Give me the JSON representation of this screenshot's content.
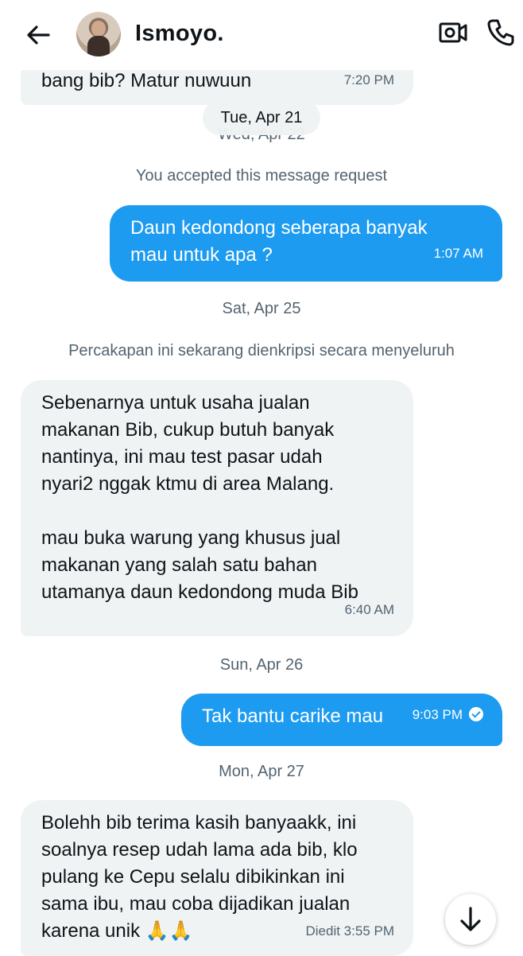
{
  "header": {
    "contact_name": "Ismoyo.",
    "back_icon": "arrow-left-icon",
    "video_icon": "video-call-icon",
    "call_icon": "phone-icon"
  },
  "messages": [
    {
      "text": "bang bib? Matur nuwuun",
      "time": "7:20 PM"
    },
    {
      "text": "Daun kedondong seberapa banyak\nmau untuk apa ?",
      "time": "1:07 AM"
    },
    {
      "text": "Sebenarnya untuk usaha jualan\nmakanan Bib,  cukup butuh banyak\nnantinya, ini mau test pasar udah\nnyari2 nggak ktmu di area Malang.\n\nmau buka warung yang khusus jual\nmakanan yang salah satu bahan\nutamanya daun kedondong muda Bib",
      "time": "6:40 AM"
    },
    {
      "text": "Tak bantu carike mau",
      "time": "9:03 PM"
    },
    {
      "text": "Bolehh bib terima kasih banyaakk, ini\nsoalnya resep udah lama ada bib, klo\npulang ke Cepu selalu dibikinkan ini\nsama ibu, mau coba dijadikan jualan\nkarena unik 🙏🙏",
      "time": "Diedit 3:55 PM"
    }
  ],
  "dates": {
    "sticky": "Tue, Apr 21",
    "wed": "Wed, Apr 22",
    "sat": "Sat, Apr 25",
    "sun": "Sun, Apr 26",
    "mon": "Mon, Apr 27"
  },
  "system": {
    "accepted": "You accepted this message request",
    "encrypted": "Percakapan ini sekarang dienkripsi secara menyeluruh"
  },
  "colors": {
    "outgoing_bubble": "#1d9bf0",
    "incoming_bubble": "#eff3f4",
    "secondary_text": "#536471"
  }
}
